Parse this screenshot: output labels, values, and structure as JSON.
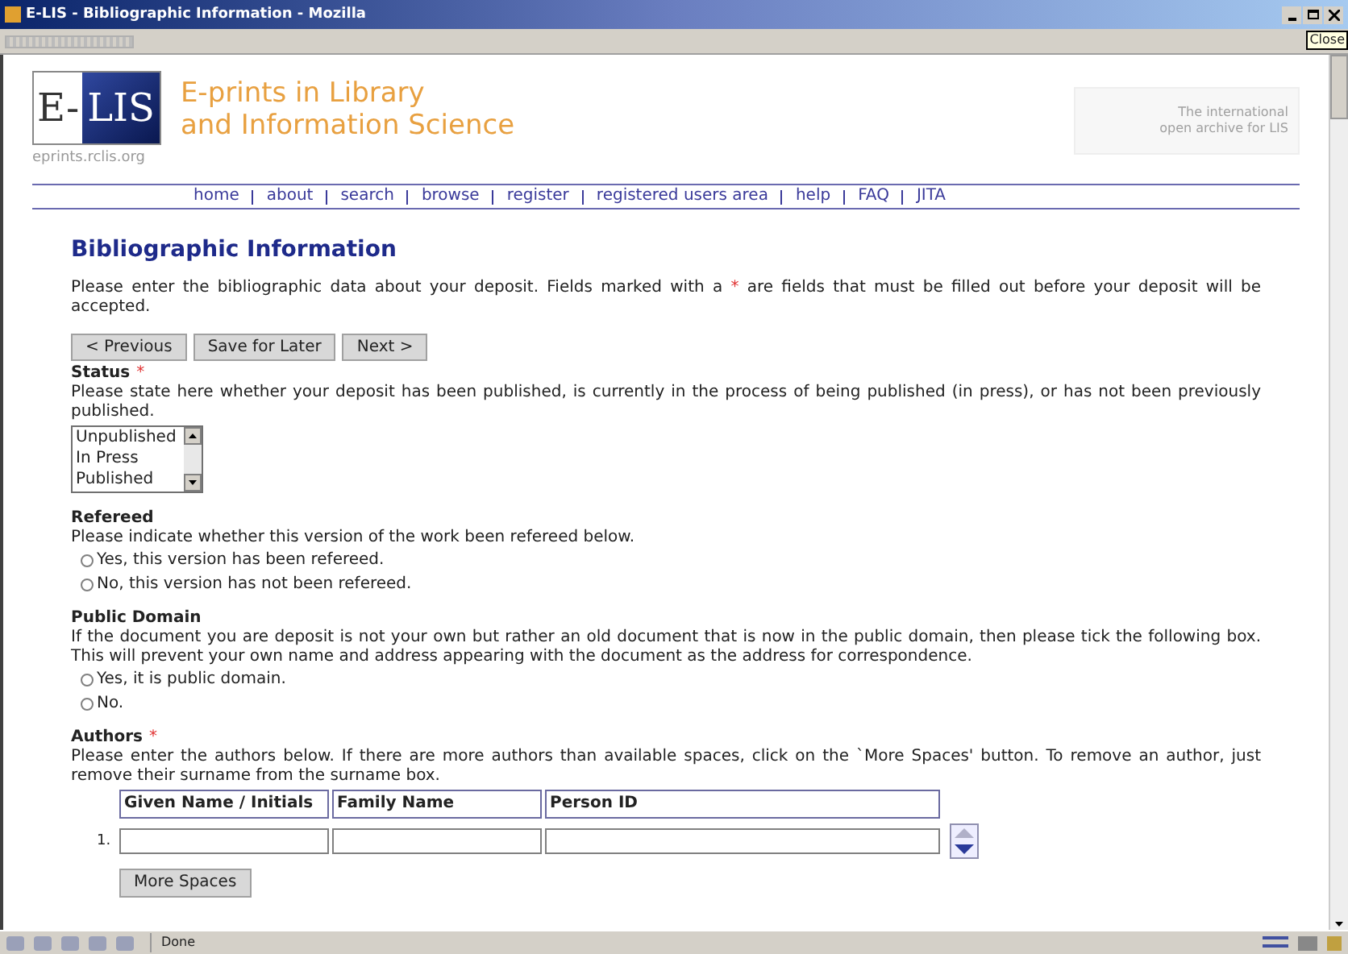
{
  "window": {
    "title": "E-LIS - Bibliographic Information - Mozilla",
    "tooltip": "Close"
  },
  "header": {
    "logo_left": "E-",
    "logo_right": "LIS",
    "logo_url": "eprints.rclis.org",
    "title_lines": [
      "E-prints in Library",
      "and Information Science"
    ],
    "tagline_lines": [
      "The international",
      "open archive for LIS"
    ]
  },
  "nav": [
    "home",
    "about",
    "search",
    "browse",
    "register",
    "registered users area",
    "help",
    "FAQ",
    "JITA"
  ],
  "page": {
    "heading": "Bibliographic Information",
    "intro": {
      "before": "Please enter the bibliographic data about your deposit. Fields marked with a",
      "mark": "*",
      "after": "are fields that must be filled out before your deposit will be accepted."
    },
    "buttons": [
      "< Previous",
      "Save for Later",
      "Next >"
    ],
    "sections": [
      {
        "kind": "listbox",
        "label": "Status",
        "required_mark": "*",
        "description": "Please state here whether your deposit has been published, is currently in the process of being published (in press), or has not been previously published.",
        "options": [
          {
            "label": "Unpublished",
            "selected": false
          },
          {
            "label": "In Press",
            "selected": false
          },
          {
            "label": "Published",
            "selected": false
          }
        ]
      },
      {
        "kind": "radio",
        "label": "Refereed",
        "description": "Please indicate whether this version of the work been refereed below.",
        "options": [
          {
            "label": "Yes, this version has been refereed.",
            "selected": false
          },
          {
            "label": "No, this version has not been refereed.",
            "selected": false
          }
        ]
      },
      {
        "kind": "radio",
        "label": "Public Domain",
        "description": "If the document you are deposit is not your own but rather an old document that is now in the public domain, then please tick the following box. This will prevent your own name and address appearing with the document as the address for correspondence.",
        "options": [
          {
            "label": "Yes, it is public domain.",
            "selected": false
          },
          {
            "label": "No.",
            "selected": false
          }
        ]
      },
      {
        "kind": "authors",
        "label": "Authors",
        "required_mark": "*",
        "description": "Please enter the authors below. If there are more authors than available spaces, click on the `More Spaces' button. To remove an author, just remove their surname from the surname box.",
        "columns": [
          "Given Name / Initials",
          "Family Name",
          "Person ID"
        ],
        "rows": [
          {
            "number": "1."
          }
        ],
        "button": "More Spaces"
      }
    ]
  },
  "status_bar": {
    "text": "Done"
  }
}
